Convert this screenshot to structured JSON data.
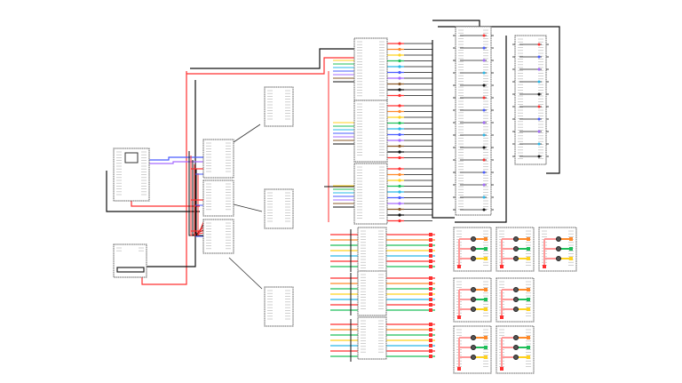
{
  "diagram": {
    "colors": {
      "power": "#ff3030",
      "ground": "#111111",
      "signal": "#4a5cff",
      "signal_alt": "#a66cff",
      "orange": "#ff8a2a",
      "green": "#1fbf5a",
      "yellow": "#ffd21f",
      "cyan": "#2ab8e8",
      "brown": "#8a5a2a",
      "box_border": "#666666",
      "panel_wire": "#ff9a9a"
    },
    "counts": {
      "hub_boards": 3,
      "driver_boards": 3,
      "top_right_modules": 3,
      "bottom_modules": 3,
      "relay_columns": 2,
      "light_panels": 7
    }
  }
}
